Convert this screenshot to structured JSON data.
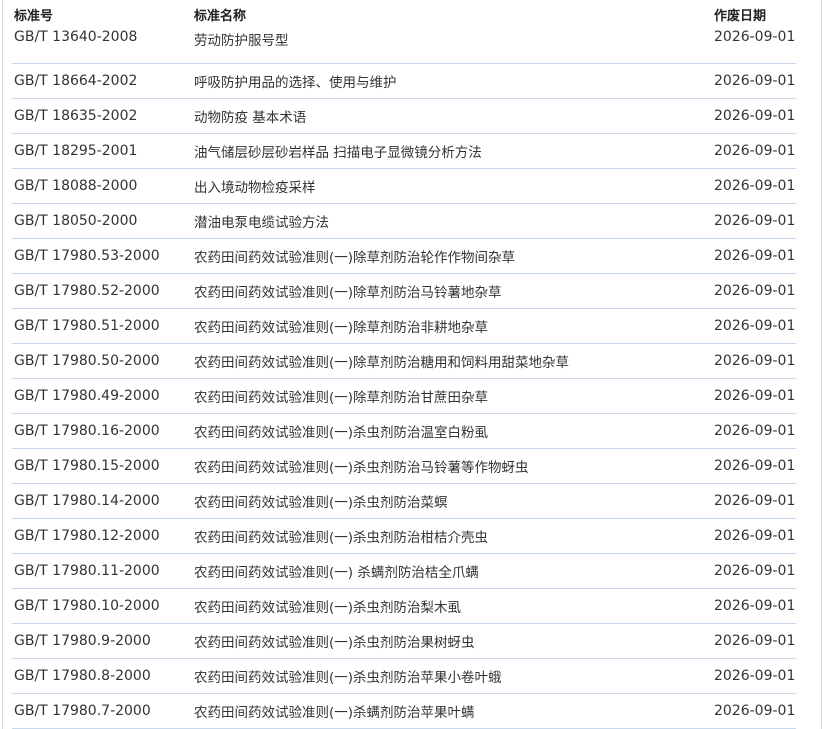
{
  "table": {
    "headers": {
      "code": "标准号",
      "name": "标准名称",
      "date": "作废日期"
    },
    "rows": [
      {
        "code": "GB/T 13640-2008",
        "name": "劳动防护服号型",
        "date": "2026-09-01"
      },
      {
        "code": "GB/T 18664-2002",
        "name": "呼吸防护用品的选择、使用与维护",
        "date": "2026-09-01"
      },
      {
        "code": "GB/T 18635-2002",
        "name": "动物防疫 基本术语",
        "date": "2026-09-01"
      },
      {
        "code": "GB/T 18295-2001",
        "name": "油气储层砂层砂岩样品 扫描电子显微镜分析方法",
        "date": "2026-09-01"
      },
      {
        "code": "GB/T 18088-2000",
        "name": "出入境动物检疫采样",
        "date": "2026-09-01"
      },
      {
        "code": "GB/T 18050-2000",
        "name": "潜油电泵电缆试验方法",
        "date": "2026-09-01"
      },
      {
        "code": "GB/T 17980.53-2000",
        "name": "农药田间药效试验准则(一)除草剂防治轮作作物间杂草",
        "date": "2026-09-01"
      },
      {
        "code": "GB/T 17980.52-2000",
        "name": "农药田间药效试验准则(一)除草剂防治马铃薯地杂草",
        "date": "2026-09-01"
      },
      {
        "code": "GB/T 17980.51-2000",
        "name": "农药田间药效试验准则(一)除草剂防治非耕地杂草",
        "date": "2026-09-01"
      },
      {
        "code": "GB/T 17980.50-2000",
        "name": "农药田间药效试验准则(一)除草剂防治糖用和饲料用甜菜地杂草",
        "date": "2026-09-01"
      },
      {
        "code": "GB/T 17980.49-2000",
        "name": "农药田间药效试验准则(一)除草剂防治甘蔗田杂草",
        "date": "2026-09-01"
      },
      {
        "code": "GB/T 17980.16-2000",
        "name": "农药田间药效试验准则(一)杀虫剂防治温室白粉虱",
        "date": "2026-09-01"
      },
      {
        "code": "GB/T 17980.15-2000",
        "name": "农药田间药效试验准则(一)杀虫剂防治马铃薯等作物蚜虫",
        "date": "2026-09-01"
      },
      {
        "code": "GB/T 17980.14-2000",
        "name": "农药田间药效试验准则(一)杀虫剂防治菜螟",
        "date": "2026-09-01"
      },
      {
        "code": "GB/T 17980.12-2000",
        "name": "农药田间药效试验准则(一)杀虫剂防治柑桔介壳虫",
        "date": "2026-09-01"
      },
      {
        "code": "GB/T 17980.11-2000",
        "name": "农药田间药效试验准则(一) 杀螨剂防治桔全爪螨",
        "date": "2026-09-01"
      },
      {
        "code": "GB/T 17980.10-2000",
        "name": "农药田间药效试验准则(一)杀虫剂防治梨木虱",
        "date": "2026-09-01"
      },
      {
        "code": "GB/T 17980.9-2000",
        "name": "农药田间药效试验准则(一)杀虫剂防治果树蚜虫",
        "date": "2026-09-01"
      },
      {
        "code": "GB/T 17980.8-2000",
        "name": "农药田间药效试验准则(一)杀虫剂防治苹果小卷叶蛾",
        "date": "2026-09-01"
      },
      {
        "code": "GB/T 17980.7-2000",
        "name": "农药田间药效试验准则(一)杀螨剂防治苹果叶螨",
        "date": "2026-09-01"
      }
    ]
  }
}
